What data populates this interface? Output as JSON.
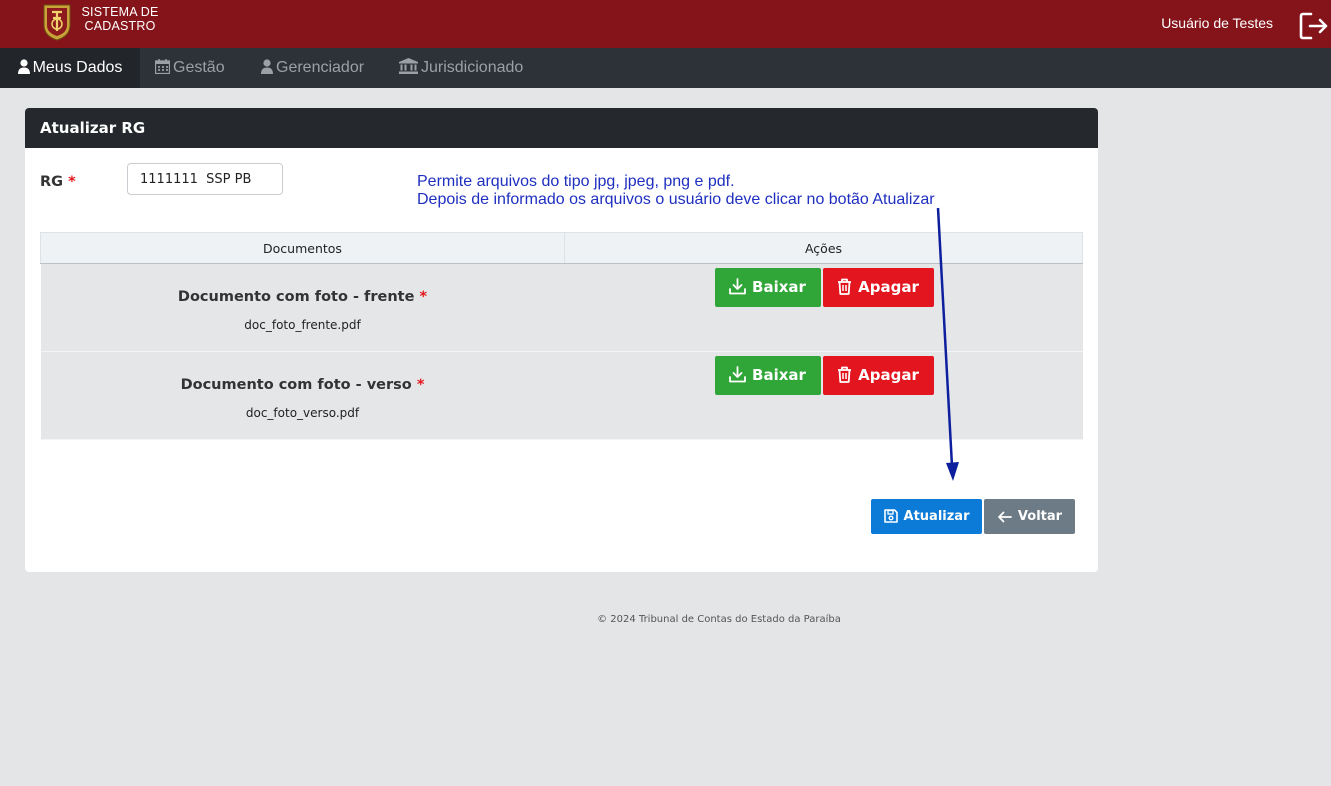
{
  "header": {
    "app_title_line1": "SISTEMA DE",
    "app_title_line2": "CADASTRO",
    "user_name": "Usuário de Testes"
  },
  "nav": {
    "items": [
      {
        "label": "Meus Dados",
        "icon": "user-icon",
        "active": true
      },
      {
        "label": "Gestão",
        "icon": "calendar-icon",
        "active": false
      },
      {
        "label": "Gerenciador",
        "icon": "user-icon",
        "active": false
      },
      {
        "label": "Jurisdicionado",
        "icon": "bank-icon",
        "active": false
      }
    ]
  },
  "card": {
    "title": "Atualizar RG",
    "rg_label": "RG",
    "required_mark": "*",
    "rg_value": "1111111  SSP PB",
    "note_line1": "Permite arquivos do tipo jpg, jpeg, png e pdf.",
    "note_line2": "Depois de informado os arquivos o usuário deve clicar no botão Atualizar"
  },
  "table": {
    "headers": [
      "Documentos",
      "Ações"
    ],
    "rows": [
      {
        "title": "Documento com foto - frente",
        "file": "doc_foto_frente.pdf"
      },
      {
        "title": "Documento com foto - verso",
        "file": "doc_foto_verso.pdf"
      }
    ],
    "download_label": "Baixar",
    "delete_label": "Apagar"
  },
  "actions": {
    "update_label": "Atualizar",
    "back_label": "Voltar"
  },
  "footer": {
    "text": "© 2024 Tribunal de Contas do Estado da Paraíba"
  },
  "colors": {
    "topbar": "#85141a",
    "navbar": "#2d3238",
    "download_button": "#31a638",
    "delete_button": "#e3161f",
    "update_button": "#0c7bd7",
    "back_button": "#6c7b86",
    "annotation": "#1f2fbf"
  }
}
